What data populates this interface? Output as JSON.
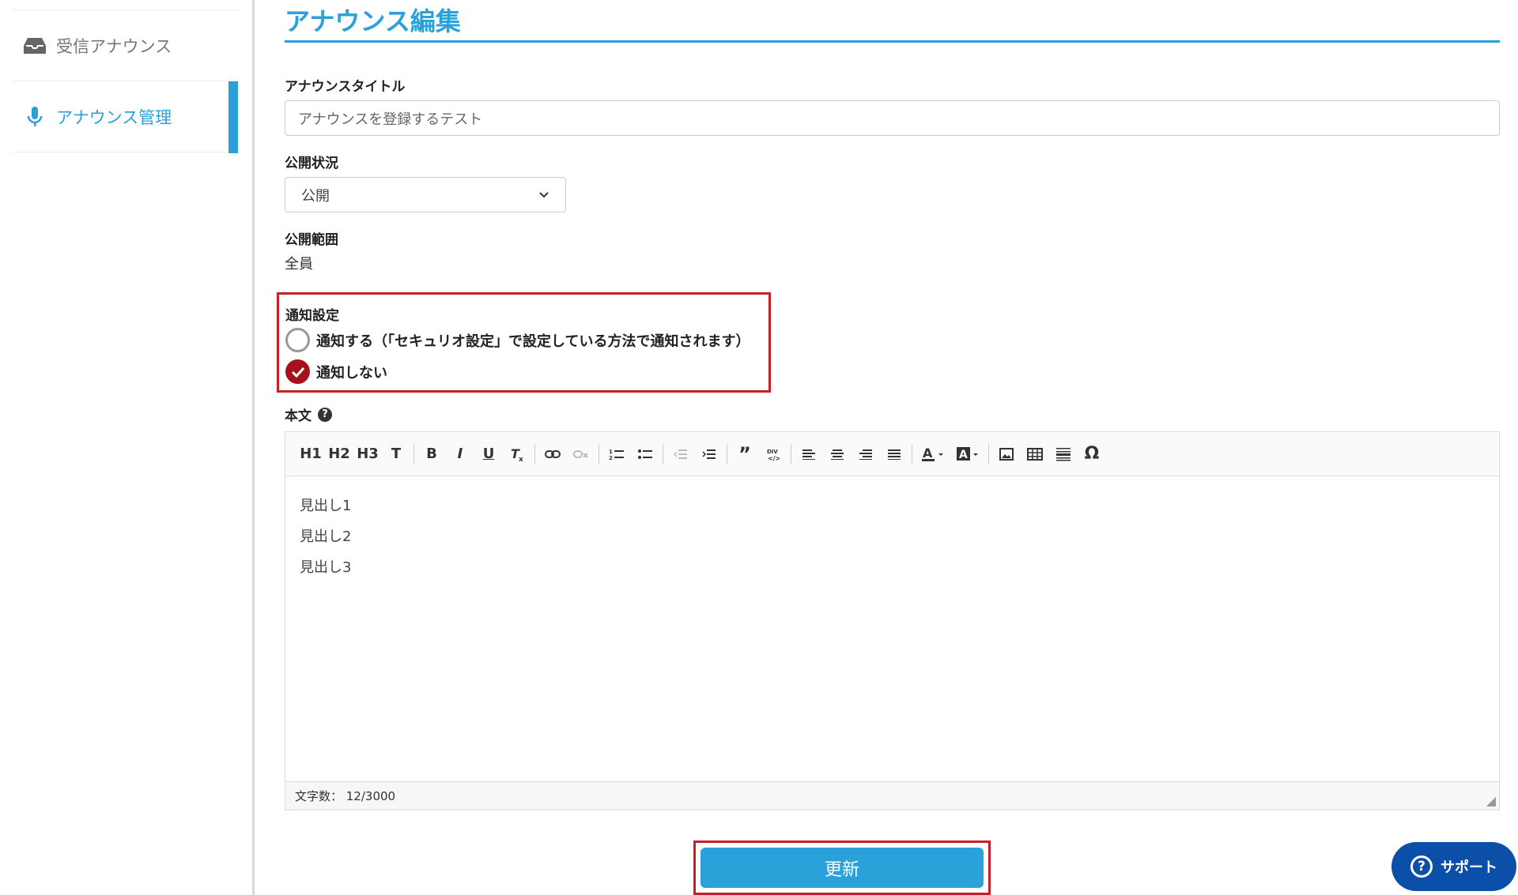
{
  "sidebar": {
    "items": [
      {
        "label": "受信アナウンス",
        "icon": "inbox-icon"
      },
      {
        "label": "アナウンス管理",
        "icon": "microphone-icon"
      }
    ]
  },
  "main": {
    "title": "アナウンス編集",
    "fields": {
      "title_label": "アナウンスタイトル",
      "title_value": "アナウンスを登録するテスト",
      "status_label": "公開状況",
      "status_value": "公開",
      "scope_label": "公開範囲",
      "scope_value": "全員",
      "notify_label": "通知設定",
      "notify_option1": "通知する（「セキュリオ設定」で設定している方法で通知されます）",
      "notify_option2": "通知しない",
      "body_label": "本文"
    },
    "toolbar": {
      "h1": "H1",
      "h2": "H2",
      "h3": "H3",
      "t": "T",
      "bold": "B",
      "italic": "I",
      "underline": "U",
      "omega": "Ω"
    },
    "editor_lines": [
      "見出し1",
      "見出し2",
      "見出し3"
    ],
    "char_count": "文字数： 12/3000",
    "update_button": "更新"
  },
  "support": {
    "label": "サポート",
    "icon": "question-circle-icon"
  },
  "colors": {
    "accent": "#2aa1d8",
    "highlight": "#c8202b",
    "checked": "#a8101e",
    "support": "#0c4fa8"
  }
}
